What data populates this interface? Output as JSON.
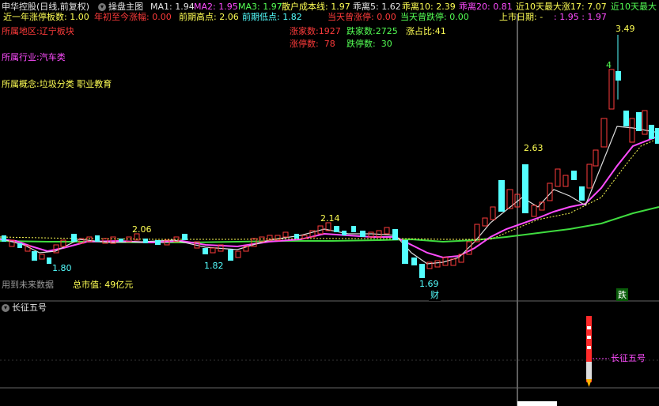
{
  "header": {
    "stock_title": "申华控股(日线,前复权)",
    "indicator_name": "操盘主图",
    "ma1": "MA1: 1.94",
    "ma2": "MA2: 1.95",
    "ma3": "MA3: 1.97",
    "retail_cost": "散户成本线: 1.97",
    "bias5": "乖离5: 1.62",
    "bias10": "乖离10: 2.39",
    "bias20": "乖离20: 0.81",
    "max_rise10": "近10天最大涨",
    "max_rise10_val": "17: 7.07",
    "max_rise10_tail": "近10天最大",
    "color_white": "#e6e6e6",
    "color_magenta": "#ff4cff",
    "color_green": "#54ff54",
    "color_yellow": "#ffff54"
  },
  "row2": {
    "limit_up_count_label": "近一年涨停板数: 1.00",
    "ytd_change_label": "年初至今涨幅: 0.00",
    "prev_high": "前期高点: 2.06",
    "prev_low": "前期低点: 1.82",
    "day_limit_up": "当天曾涨停: 0.00",
    "day_limit_down": "当天曾跌停: 0.00",
    "listing_date": "上市日期: -",
    "listing_tail": ": 1.95 : 1.97"
  },
  "info": {
    "region": "所属地区:辽宁板块",
    "industry": "所属行业:汽车类",
    "concept": "所属概念:垃圾分类 职业教育",
    "up_count_label": "涨家数:1927",
    "down_count_label": "跌家数:2725",
    "ratio_label": "涨占比:41",
    "limit_up_label": "涨停数:",
    "limit_up_val": "78",
    "limit_down_label": "跌停数:",
    "limit_down_val": "30",
    "future_data": "用到未来数据",
    "market_cap": "总市值: 49亿元"
  },
  "annotations": {
    "p206": "2.06",
    "p180": "1.80",
    "p182": "1.82",
    "p214": "2.14",
    "p169": "1.69",
    "p263": "2.63",
    "p349": "3.49",
    "p4": "4",
    "cai": "财",
    "die": "跌"
  },
  "sub_panel": {
    "title": "长征五号",
    "label": "长征五号"
  }
}
